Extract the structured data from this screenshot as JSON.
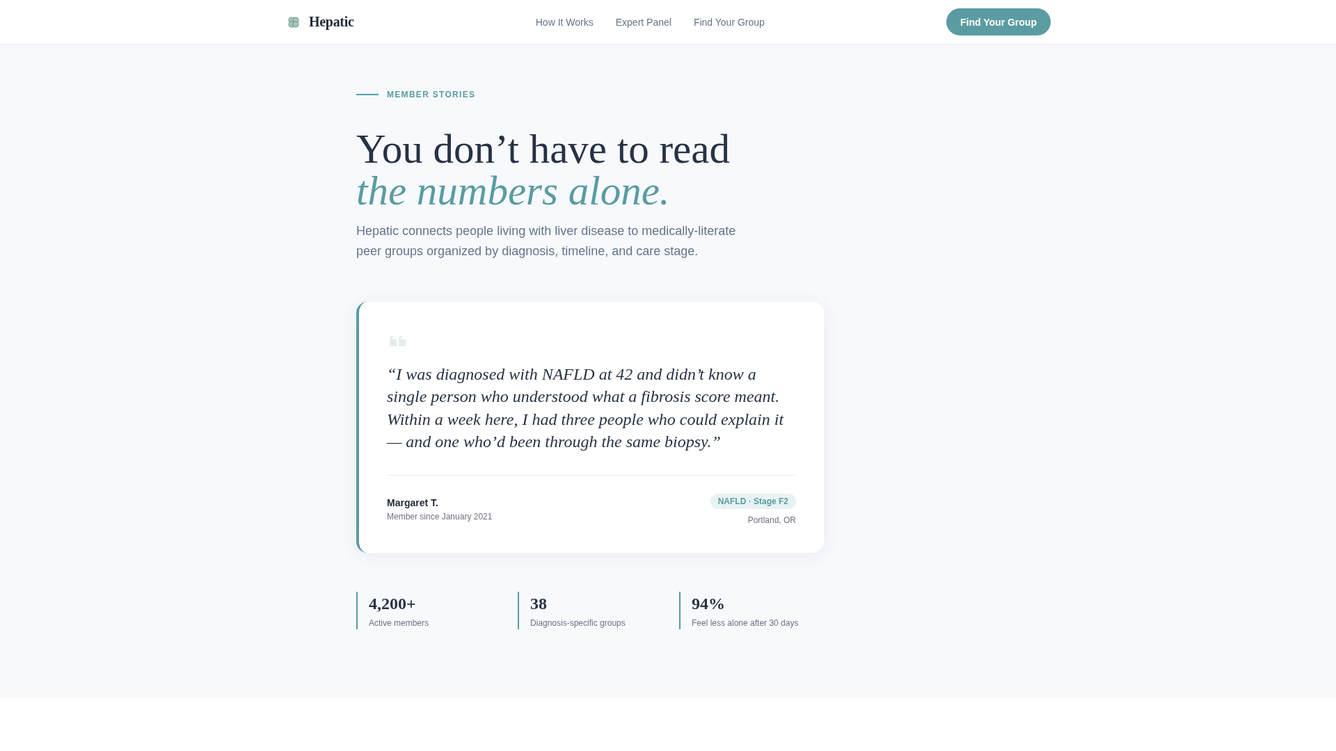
{
  "header": {
    "logo": "Hepatic",
    "nav": [
      "How It Works",
      "Expert Panel",
      "Find Your Group"
    ],
    "cta": "Find Your Group"
  },
  "hero": {
    "eyebrow": "MEMBER STORIES",
    "title": "You don’t have to read *the numbers alone.*",
    "description": "Hepatic connects people living with liver disease to medically-literate peer groups organized by diagnosis, timeline, and care stage."
  },
  "testimonial": {
    "quote": "“I was diagnosed with NAFLD at 42 and didn’t know a single person who understood what a fibrosis score meant. Within a week here, I had three people who could explain it — and one who’d been through the same biopsy.”",
    "author": "Margaret T.",
    "member_since": "Member since January 2021",
    "badge": "NAFLD · Stage F2",
    "location": "Portland, OR"
  },
  "stats": [
    {
      "value": "4,200+",
      "label": "Active members"
    },
    {
      "value": "38",
      "label": "Diagnosis-specific groups"
    },
    {
      "value": "94%",
      "label": "Feel less alone after 30 days"
    }
  ]
}
